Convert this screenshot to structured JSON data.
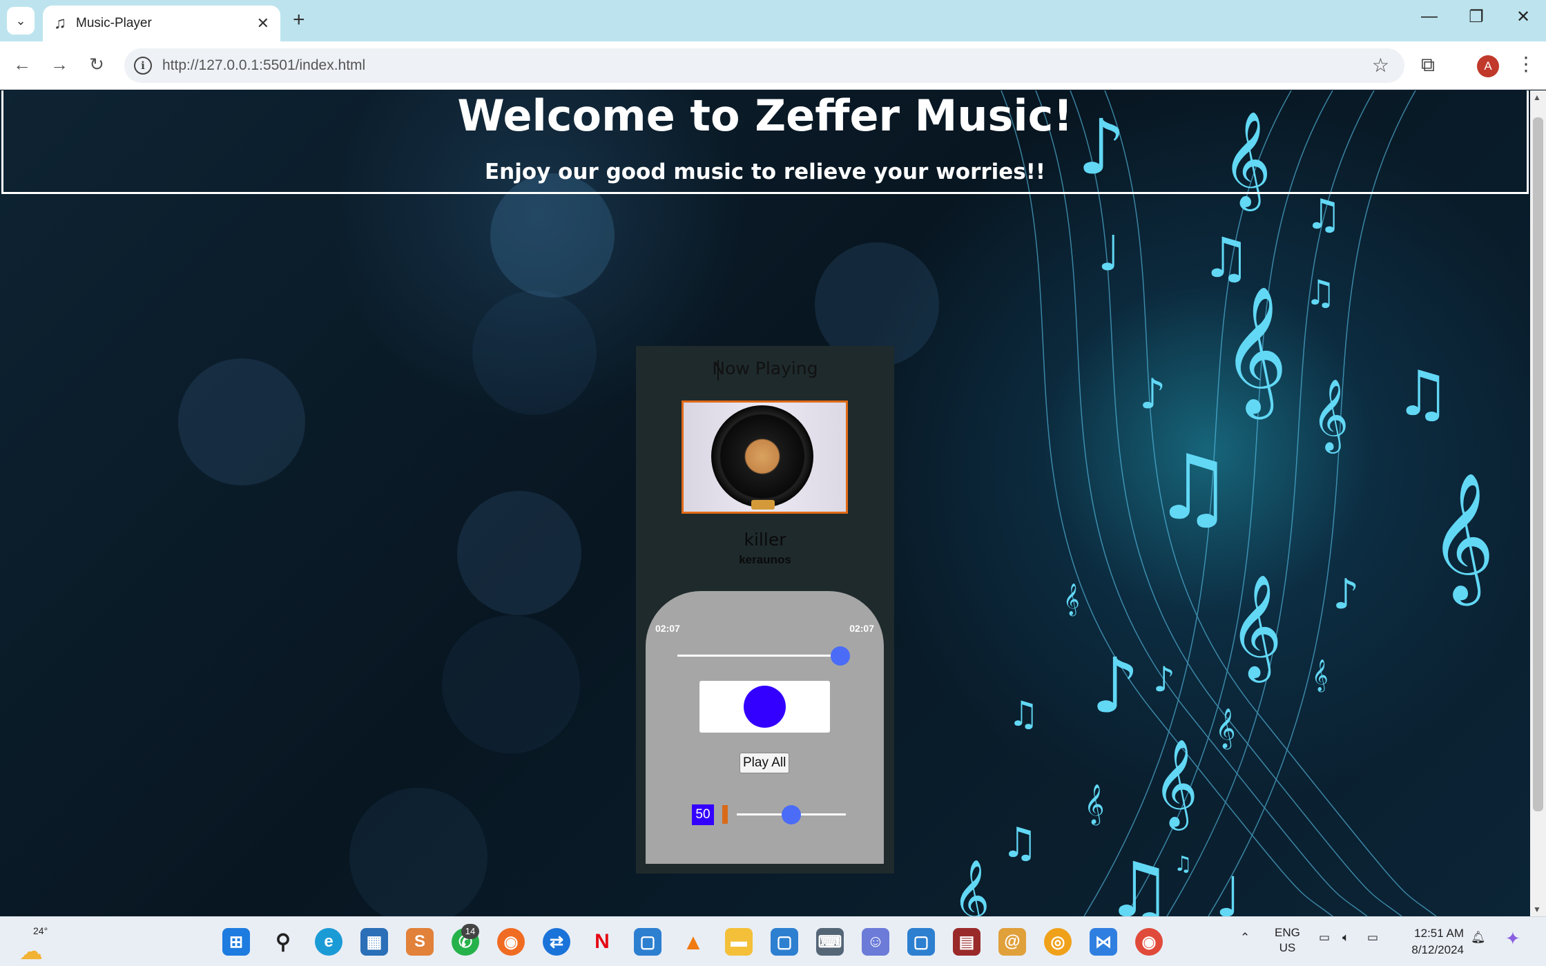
{
  "browser": {
    "tab_title": "Music-Player",
    "url": "http://127.0.0.1:5501/index.html",
    "profile_initial": "A"
  },
  "page": {
    "title": "Welcome to Zeffer Music!",
    "subtitle": "Enjoy our good music to relieve your worries!!"
  },
  "player": {
    "heading": "Now Playing",
    "song_title": "killer",
    "artist": "keraunos",
    "current_time": "02:07",
    "duration": "02:07",
    "progress": 1.0,
    "play_all_label": "Play All",
    "volume": "50",
    "volume_level": 0.5
  },
  "taskbar": {
    "temperature": "24°",
    "whatsapp_badge": "14",
    "language_line1": "ENG",
    "language_line2": "US",
    "time": "12:51 AM",
    "date": "8/12/2024"
  },
  "colors": {
    "accent_blue": "#3300ff",
    "slider_thumb": "#4a6cf7",
    "cover_border": "#e06a17"
  }
}
